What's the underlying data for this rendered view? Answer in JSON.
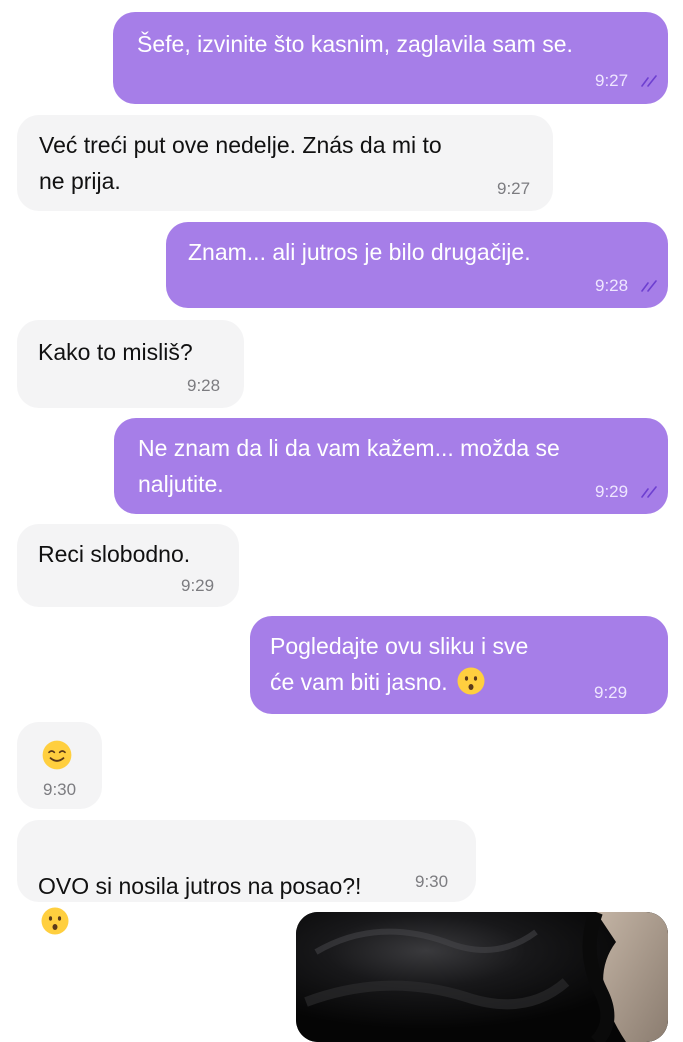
{
  "colors": {
    "outgoing_bubble": "#a67ee8",
    "incoming_bubble": "#f4f4f5",
    "read_ticks": "#6d3fd0"
  },
  "messages": [
    {
      "dir": "out",
      "text": "Šefe, izvinite što kasnim, zaglavila sam se.",
      "time": "9:27",
      "read": true
    },
    {
      "dir": "in",
      "text": "Već treći put ove nedelje. Znás da mi to\nne prija.",
      "time": "9:27"
    },
    {
      "dir": "out",
      "text": "Znam... ali jutros je bilo drugačije.",
      "time": "9:28",
      "read": true
    },
    {
      "dir": "in",
      "text": "Kako to misliš?",
      "time": "9:28"
    },
    {
      "dir": "out",
      "text": "Ne znam da li da vam kažem... možda se\nnaljutite.",
      "time": "9:29",
      "read": true
    },
    {
      "dir": "in",
      "text": "Reci slobodno.",
      "time": "9:29"
    },
    {
      "dir": "out",
      "text": "Pogledajte ovu sliku i sve\nće vam biti jasno.",
      "time": "9:29",
      "emoji": "hushed-face-emoji"
    },
    {
      "dir": "in",
      "text": "",
      "time": "9:30",
      "emoji": "smiling-face-emoji"
    },
    {
      "dir": "in",
      "text": "OVO si nosila jutros na posao?!",
      "time": "9:30",
      "emoji": "hushed-face-emoji"
    }
  ],
  "attachment": {
    "type": "photo",
    "icon": "photo-dark-fabric"
  }
}
